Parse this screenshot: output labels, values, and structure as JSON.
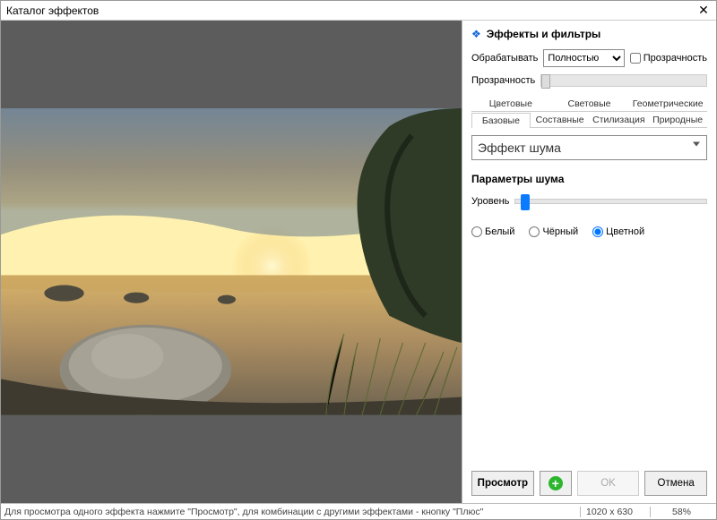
{
  "window": {
    "title": "Каталог эффектов"
  },
  "panel": {
    "header": "Эффекты и фильтры",
    "process_label": "Обрабатывать",
    "process_mode": "Полностью",
    "transparency_chk": "Прозрачность",
    "opacity_label": "Прозрачность"
  },
  "tabs": {
    "row1": [
      "Цветовые",
      "Световые",
      "Геометрические"
    ],
    "row2": [
      "Базовые",
      "Составные",
      "Стилизация",
      "Природные"
    ],
    "active": "Базовые"
  },
  "effect": {
    "selected": "Эффект шума",
    "group_title": "Параметры шума",
    "level_label": "Уровень",
    "radio_white": "Белый",
    "radio_black": "Чёрный",
    "radio_color": "Цветной",
    "radio_selected": "Цветной"
  },
  "buttons": {
    "preview": "Просмотр",
    "ok": "OK",
    "cancel": "Отмена"
  },
  "status": {
    "message": "Для просмотра одного эффекта нажмите \"Просмотр\", для комбинации с другими эффектами - кнопку \"Плюс\"",
    "dimensions": "1020 x 630",
    "percent": "58%"
  }
}
